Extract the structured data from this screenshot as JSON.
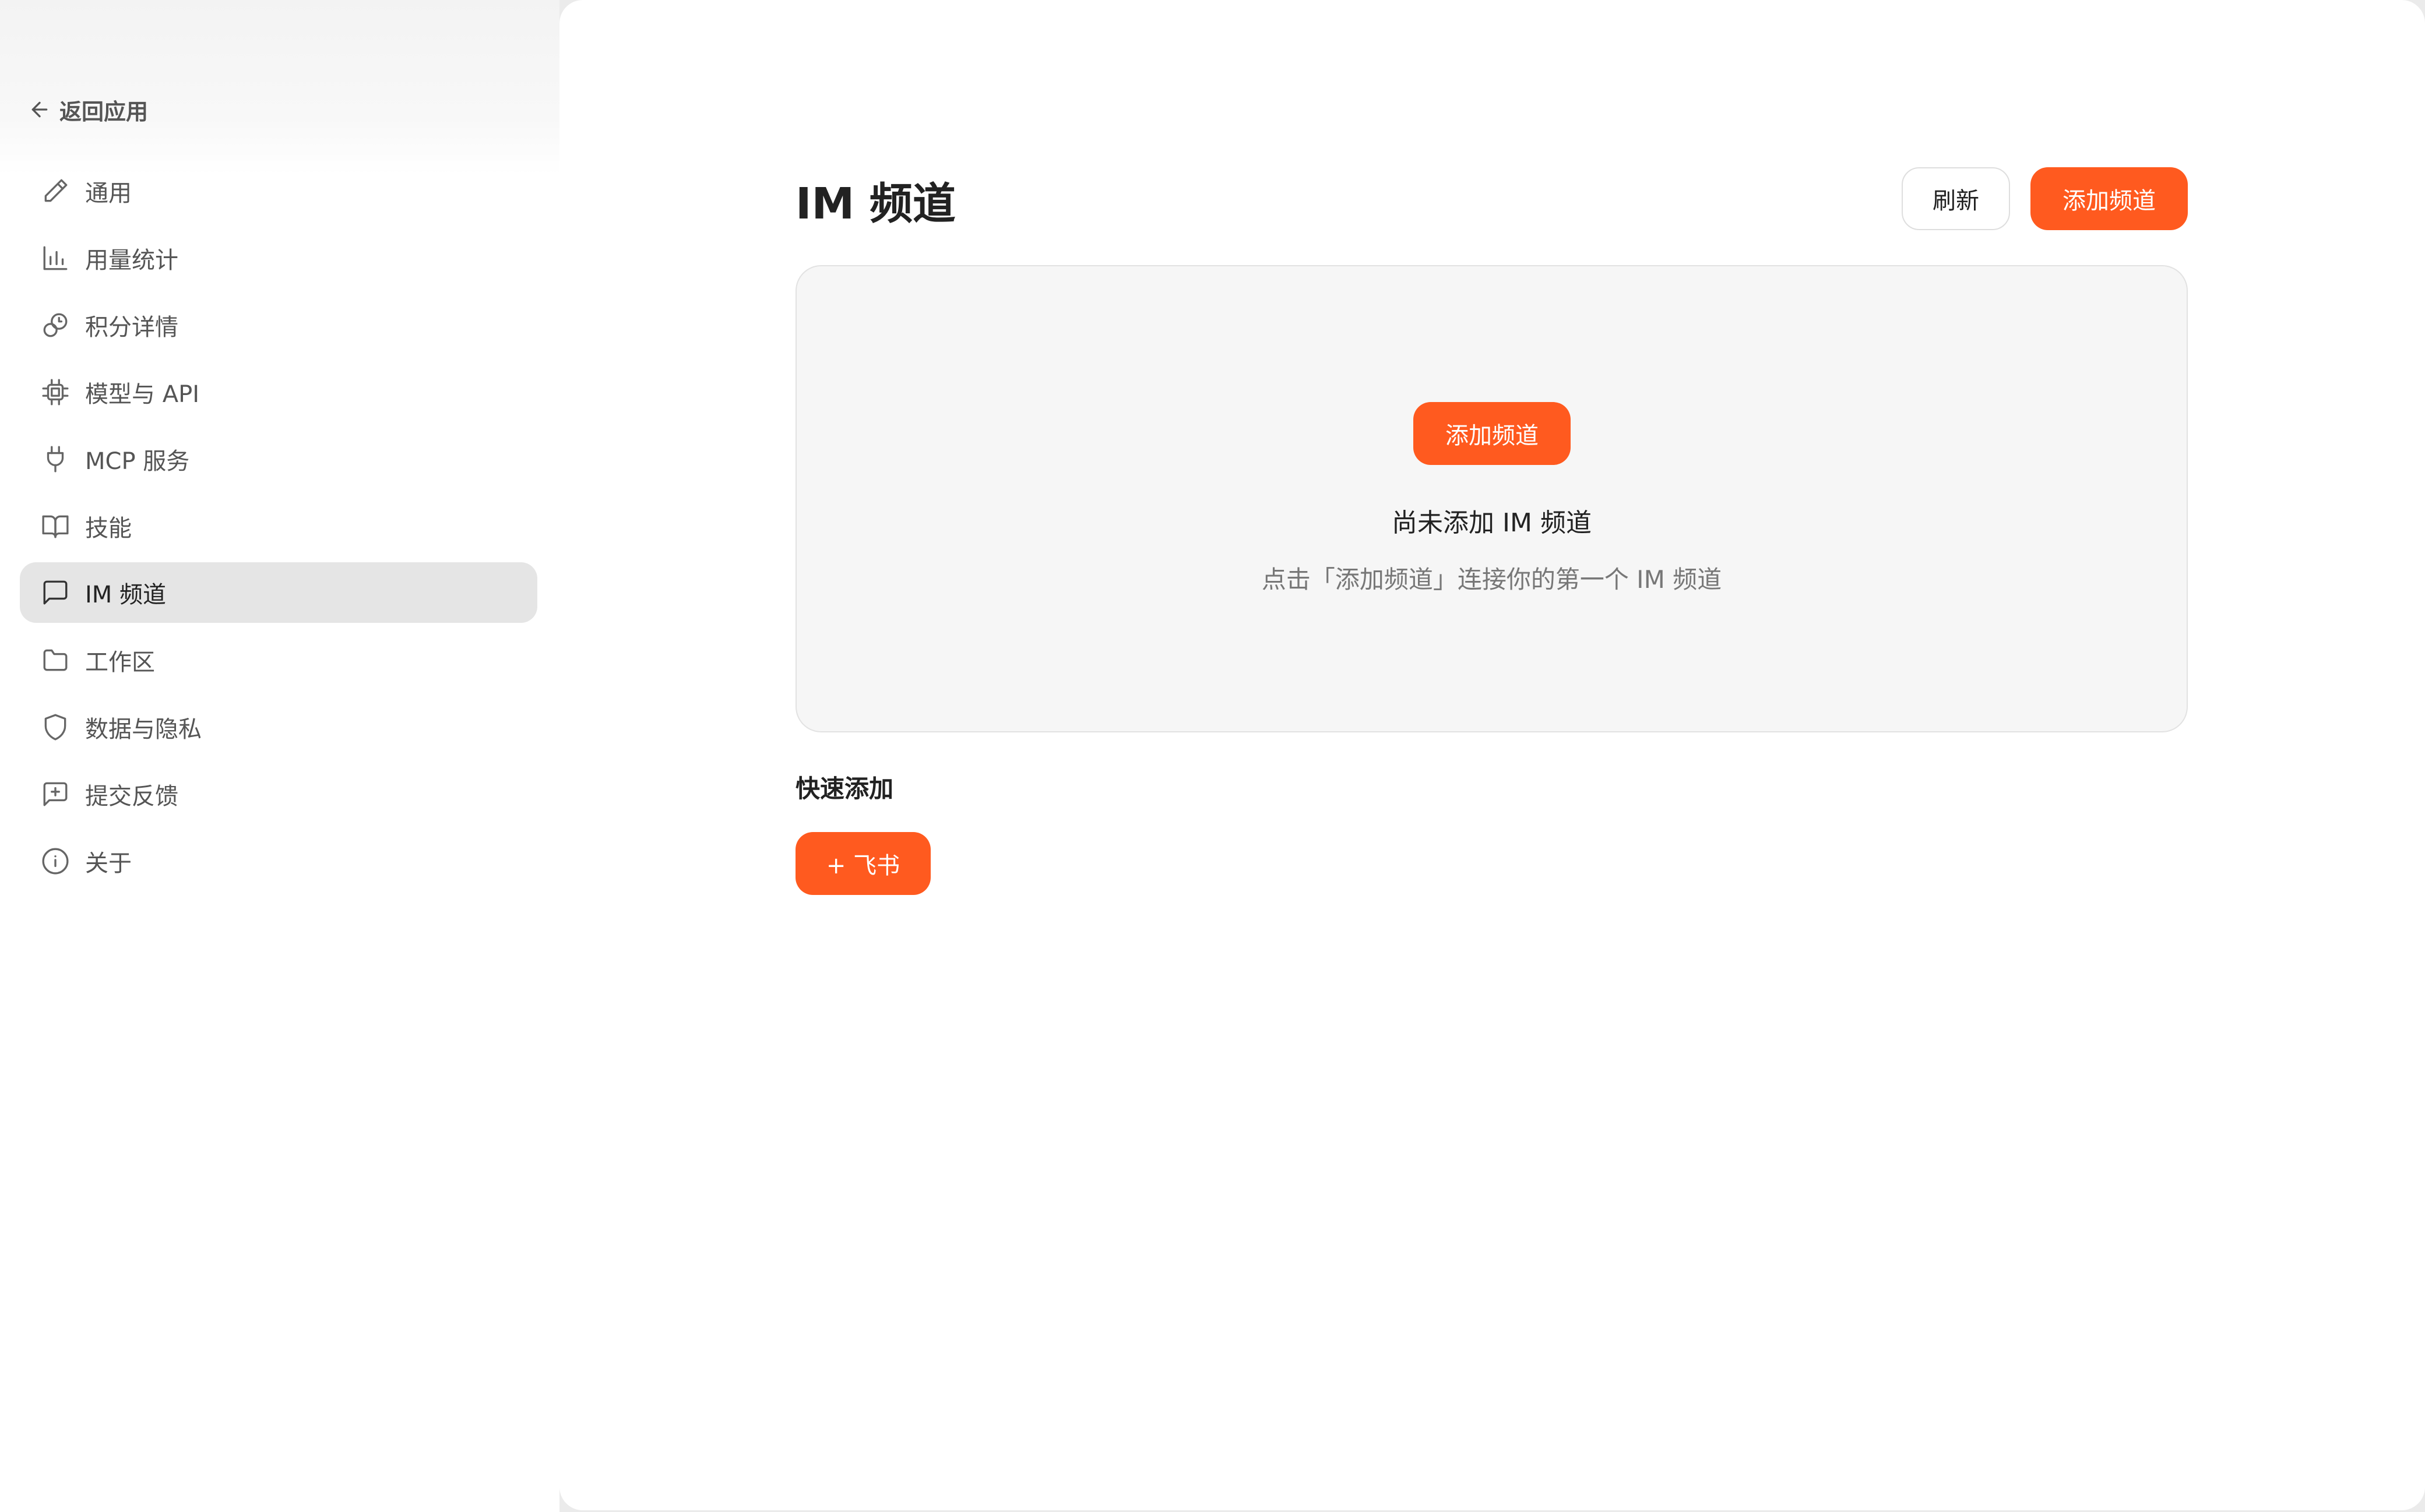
{
  "sidebar": {
    "back_label": "返回应用",
    "items": [
      {
        "label": "通用",
        "icon": "pencil-icon"
      },
      {
        "label": "用量统计",
        "icon": "bar-chart-icon"
      },
      {
        "label": "积分详情",
        "icon": "coins-icon"
      },
      {
        "label": "模型与 API",
        "icon": "chip-icon"
      },
      {
        "label": "MCP 服务",
        "icon": "plug-icon"
      },
      {
        "label": "技能",
        "icon": "book-icon"
      },
      {
        "label": "IM 频道",
        "icon": "message-square-icon"
      },
      {
        "label": "工作区",
        "icon": "folder-icon"
      },
      {
        "label": "数据与隐私",
        "icon": "shield-icon"
      },
      {
        "label": "提交反馈",
        "icon": "message-plus-icon"
      },
      {
        "label": "关于",
        "icon": "info-icon"
      }
    ],
    "active_index": 6
  },
  "main": {
    "title": "IM 频道",
    "refresh_label": "刷新",
    "add_channel_label": "添加频道",
    "empty": {
      "button_label": "添加频道",
      "title": "尚未添加 IM 频道",
      "description": "点击「添加频道」连接你的第一个 IM 频道"
    },
    "quick_add": {
      "title": "快速添加",
      "feishu_label": "+ 飞书"
    }
  },
  "colors": {
    "accent": "#ff5a1f",
    "active_bg": "#e5e5e5",
    "card_bg": "#f6f6f6"
  }
}
